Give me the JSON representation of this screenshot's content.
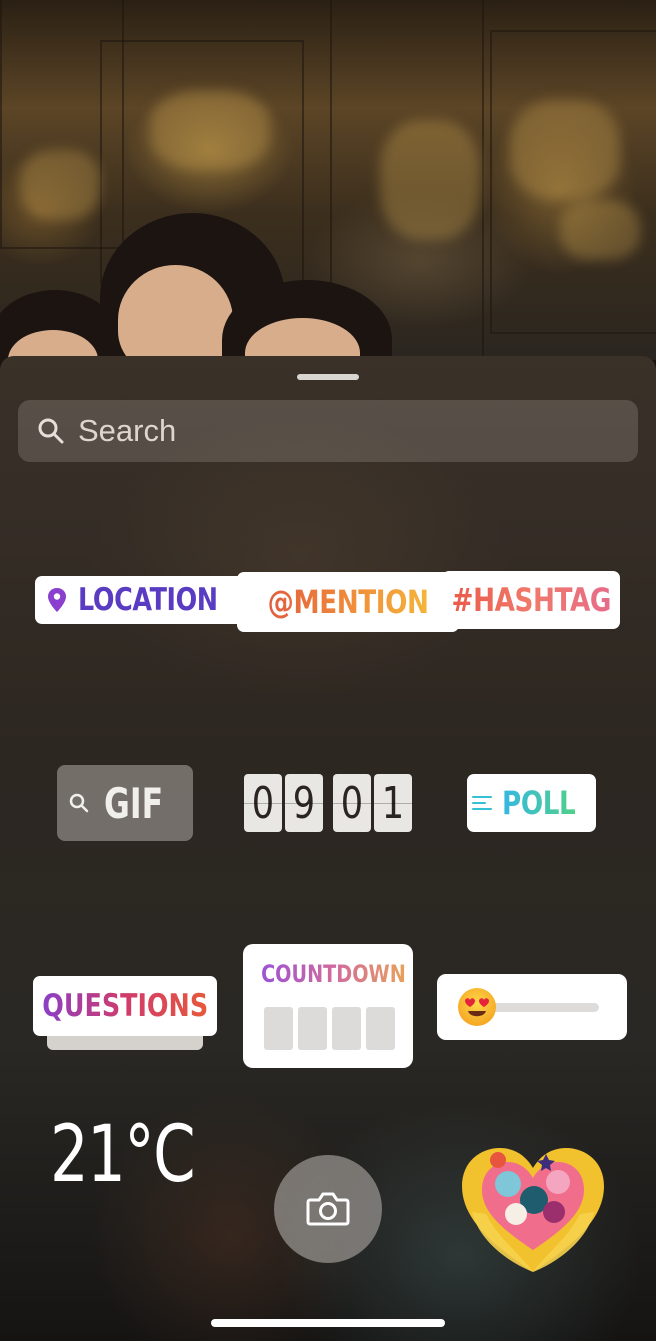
{
  "search": {
    "placeholder": "Search",
    "icon": "search-icon"
  },
  "stickers": {
    "location": {
      "label": "LOCATION",
      "icon": "location-pin-icon"
    },
    "mention": {
      "label": "@MENTION"
    },
    "hashtag": {
      "label": "#HASHTAG"
    },
    "gif": {
      "label": "GIF",
      "icon": "search-icon"
    },
    "time": {
      "digits": [
        "0",
        "9",
        "0",
        "1"
      ]
    },
    "poll": {
      "label": "POLL",
      "icon": "poll-lines-icon"
    },
    "questions": {
      "label": "QUESTIONS"
    },
    "countdown": {
      "label": "COUNTDOWN"
    },
    "emoji_slider": {
      "emoji": "heart-eyes-emoji",
      "level": 0
    },
    "temperature": {
      "label": "21°C"
    },
    "camera": {
      "icon": "camera-icon"
    },
    "heart_art": {
      "icon": "floral-heart-hands-icon"
    }
  },
  "colors": {
    "location": "#5a3cc3",
    "poll_accent": "#35c0d5",
    "sheet_bg": "#2d2721"
  }
}
